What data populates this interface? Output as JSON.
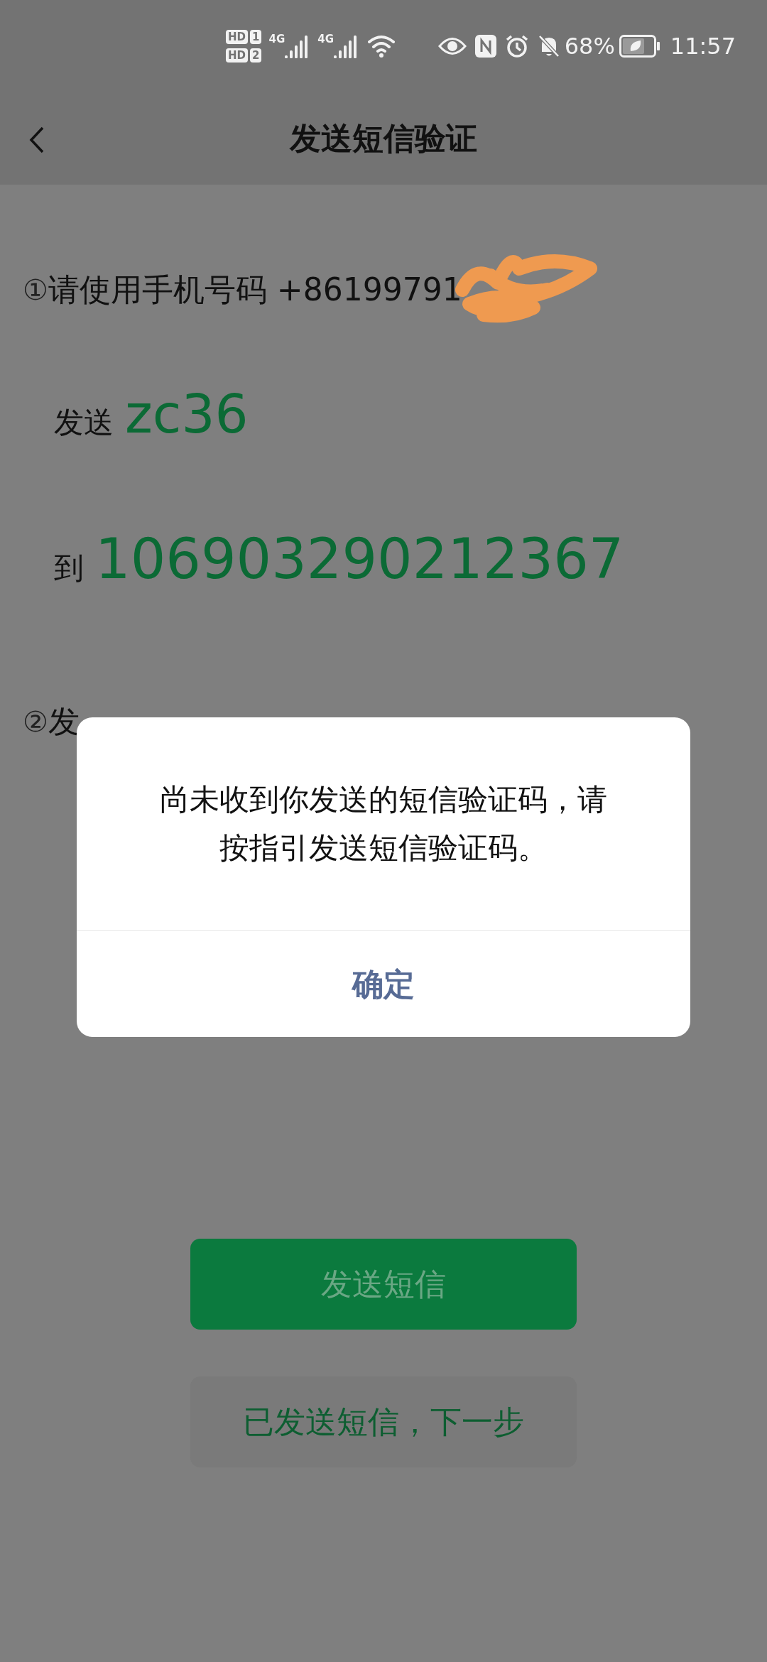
{
  "status_bar": {
    "sims": [
      {
        "hd": "HD",
        "slot": "1"
      },
      {
        "hd": "HD",
        "slot": "2"
      }
    ],
    "networks": [
      "4G",
      "4G"
    ],
    "battery": "68%",
    "time": "11:57"
  },
  "header": {
    "title": "发送短信验证"
  },
  "steps": [
    {
      "marker": "①",
      "text": "请使用手机号码 +86199791",
      "redacted": true
    },
    {
      "marker": "②",
      "text": "发",
      "redacted": false
    }
  ],
  "send": {
    "label": "发送",
    "code": "zc36"
  },
  "to": {
    "label": "到",
    "number": "106903290212367"
  },
  "dialog": {
    "message": "尚未收到你发送的短信验证码，请按指引发送短信验证码。",
    "button": "确定"
  },
  "buttons": [
    {
      "label": "发送短信",
      "kind": "primary"
    },
    {
      "label": "已发送短信，下一步",
      "kind": "secondary"
    }
  ]
}
